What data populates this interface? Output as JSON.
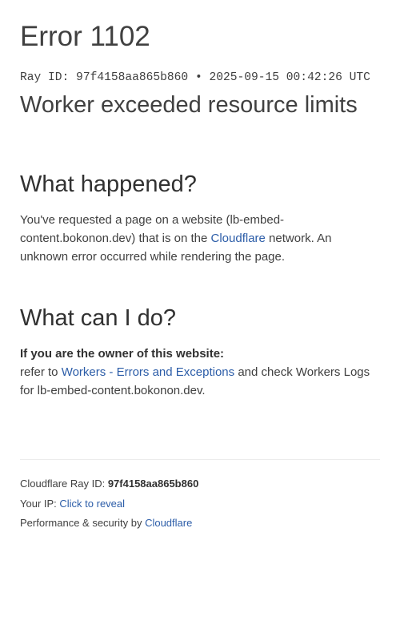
{
  "header": {
    "title": "Error 1102",
    "ray_line": "Ray ID: 97f4158aa865b860 • 2025-09-15 00:42:26 UTC",
    "subtitle": "Worker exceeded resource limits"
  },
  "what_happened": {
    "heading": "What happened?",
    "text_before_link": "You've requested a page on a website (lb-embed-content.bokonon.dev) that is on the ",
    "link_label": "Cloudflare",
    "text_after_link": " network. An unknown error occurred while rendering the page."
  },
  "what_can_i_do": {
    "heading": "What can I do?",
    "owner_label": "If you are the owner of this website:",
    "text_before_link": "refer to ",
    "link_label": "Workers - Errors and Exceptions",
    "text_after_link": " and check Workers Logs for lb-embed-content.bokonon.dev."
  },
  "footer": {
    "ray_label": "Cloudflare Ray ID: ",
    "ray_value": "97f4158aa865b860",
    "ip_label": "Your IP: ",
    "ip_link": "Click to reveal",
    "perf_label": "Performance & security by ",
    "perf_link": "Cloudflare"
  },
  "colors": {
    "link": "#2c5da8",
    "text": "#404040",
    "divider": "#ececec"
  }
}
